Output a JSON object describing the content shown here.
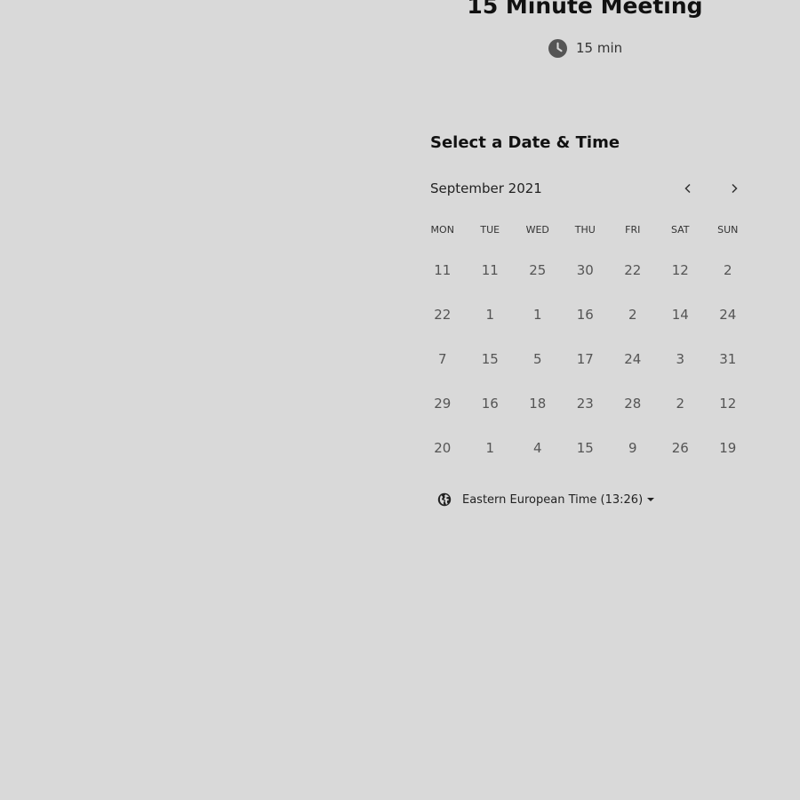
{
  "event": {
    "title": "15 Minute Meeting",
    "duration": "15 min"
  },
  "scheduler": {
    "heading": "Select a Date & Time",
    "month": "September 2021",
    "weekdays": [
      "MON",
      "TUE",
      "WED",
      "THU",
      "FRI",
      "SAT",
      "SUN"
    ],
    "weeks": [
      [
        "11",
        "11",
        "25",
        "30",
        "22",
        "12",
        "2"
      ],
      [
        "22",
        "1",
        "1",
        "16",
        "2",
        "14",
        "24"
      ],
      [
        "7",
        "15",
        "5",
        "17",
        "24",
        "3",
        "31"
      ],
      [
        "29",
        "16",
        "18",
        "23",
        "28",
        "2",
        "12"
      ],
      [
        "20",
        "1",
        "4",
        "15",
        "9",
        "26",
        "19"
      ]
    ],
    "timezone": "Eastern European Time (13:26)"
  },
  "icons": {
    "duration": "clock-icon",
    "prev": "chevron-left-icon",
    "next": "chevron-right-icon",
    "timezone": "globe-icon",
    "timezone_dropdown": "caret-down-icon"
  },
  "colors": {
    "background": "#d9d9d9",
    "text": "#1a1a1a",
    "day_text": "#555555"
  }
}
